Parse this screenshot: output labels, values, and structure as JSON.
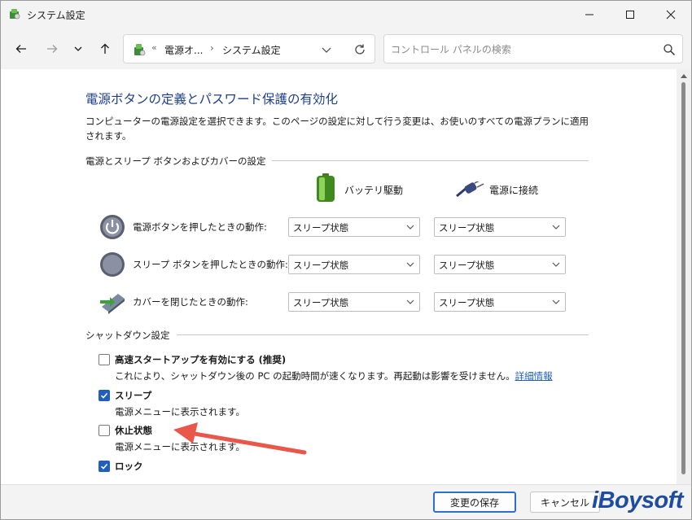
{
  "window": {
    "title": "システム設定",
    "icon": "control-panel-icon"
  },
  "navigation": {
    "breadcrumb_overflow": "«",
    "crumb_1": "電源オ...",
    "crumb_separator": "›",
    "crumb_2": "システム設定",
    "search_placeholder": "コントロール パネルの検索"
  },
  "page": {
    "title": "電源ボタンの定義とパスワード保護の有効化",
    "description": "コンピューターの電源設定を選択できます。このページの設定に対して行う変更は、お使いのすべての電源プランに適用されます。"
  },
  "power_section": {
    "heading": "電源とスリープ ボタンおよびカバーの設定",
    "col_battery": "バッテリ駆動",
    "col_plugged": "電源に接続",
    "rows": [
      {
        "label": "電源ボタンを押したときの動作:",
        "battery": "スリープ状態",
        "plugged": "スリープ状態",
        "icon": "power-button-icon"
      },
      {
        "label": "スリープ ボタンを押したときの動作:",
        "battery": "スリープ状態",
        "plugged": "スリープ状態",
        "icon": "sleep-button-icon"
      },
      {
        "label": "カバーを閉じたときの動作:",
        "battery": "スリープ状態",
        "plugged": "スリープ状態",
        "icon": "laptop-lid-icon"
      }
    ]
  },
  "shutdown_section": {
    "heading": "シャットダウン設定",
    "items": [
      {
        "label": "高速スタートアップを有効にする (推奨)",
        "checked": false,
        "description": "これにより、シャットダウン後の PC の起動時間が速くなります。再起動は影響を受けません。",
        "link": "詳細情報"
      },
      {
        "label": "スリープ",
        "checked": true,
        "description": "電源メニューに表示されます。"
      },
      {
        "label": "休止状態",
        "checked": false,
        "description": "電源メニューに表示されます。"
      },
      {
        "label": "ロック",
        "checked": true
      }
    ]
  },
  "footer": {
    "save_label": "変更の保存",
    "cancel_label": "キャンセル",
    "watermark": "iBoysoft"
  },
  "colors": {
    "title_blue": "#1e3f87",
    "checkbox_blue": "#1f5fbf",
    "annotation_arrow": "#e8574a"
  }
}
